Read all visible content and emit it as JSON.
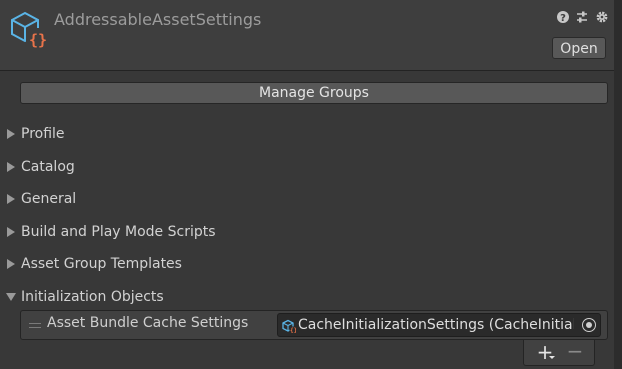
{
  "header": {
    "title": "AddressableAssetSettings",
    "icon": "addressable-settings-icon",
    "open_label": "Open",
    "icons": [
      "help-icon",
      "preset-icon",
      "gear-icon"
    ]
  },
  "manage_groups_label": "Manage Groups",
  "sections": [
    {
      "label": "Profile",
      "expanded": false
    },
    {
      "label": "Catalog",
      "expanded": false
    },
    {
      "label": "General",
      "expanded": false
    },
    {
      "label": "Build and Play Mode Scripts",
      "expanded": false
    },
    {
      "label": "Asset Group Templates",
      "expanded": false
    },
    {
      "label": "Initialization Objects",
      "expanded": true
    }
  ],
  "init_objects": {
    "items": [
      {
        "label": "Asset Bundle Cache Settings",
        "value": "CacheInitializationSettings (CacheInitializationSettings)"
      }
    ],
    "add_icon": "plus-icon",
    "remove_icon": "minus-icon"
  },
  "colors": {
    "background": "#383838",
    "icon_blue": "#5ab4e6",
    "icon_orange": "#e8734a"
  }
}
